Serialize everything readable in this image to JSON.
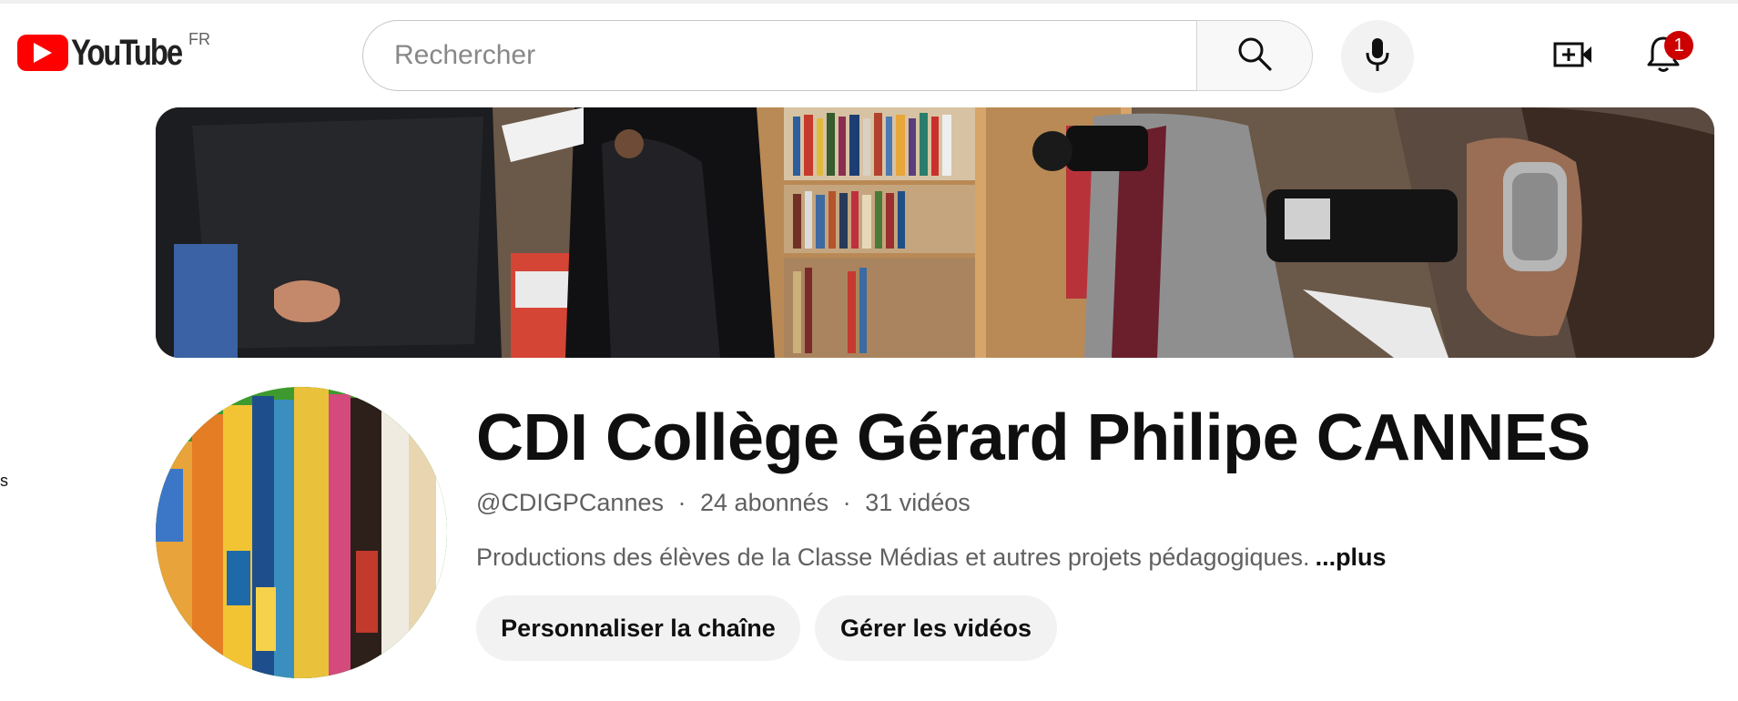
{
  "masthead": {
    "logo_text": "YouTube",
    "country_code": "FR",
    "search": {
      "placeholder": "Rechercher",
      "value": ""
    },
    "icons": {
      "search": "search-icon",
      "mic": "microphone-icon",
      "create": "create-video-icon",
      "notifications": "bell-icon"
    },
    "notification_count": "1"
  },
  "sidebar": {
    "partial_text": "s"
  },
  "channel": {
    "title": "CDI Collège Gérard Philipe CANNES",
    "handle": "@CDIGPCannes",
    "subscribers": "24 abonnés",
    "videos": "31 vidéos",
    "separator": "·",
    "description": "Productions des élèves de la Classe Médias et autres projets pédagogiques.",
    "more_label": "...plus",
    "buttons": {
      "customize": "Personnaliser la chaîne",
      "manage": "Gérer les vidéos"
    }
  },
  "colors": {
    "brand_red": "#ff0000",
    "badge_red": "#cc0000",
    "pill_bg": "#f2f2f2",
    "secondary_text": "#606060"
  }
}
